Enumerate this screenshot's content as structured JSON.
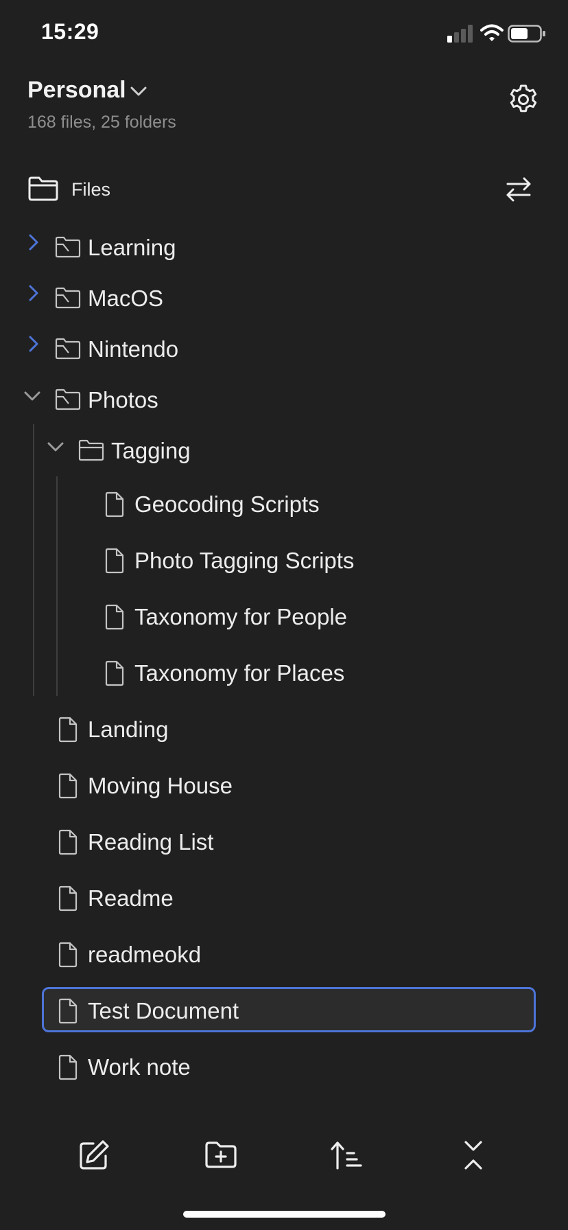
{
  "status_bar": {
    "time": "15:29"
  },
  "header": {
    "vault_name": "Personal",
    "stats": "168 files, 25 folders"
  },
  "files_section": {
    "label": "Files"
  },
  "tree": {
    "folders": [
      {
        "label": "Learning",
        "expanded": false
      },
      {
        "label": "MacOS",
        "expanded": false
      },
      {
        "label": "Nintendo",
        "expanded": false
      },
      {
        "label": "Photos",
        "expanded": true
      }
    ],
    "subfolder": {
      "label": "Tagging",
      "expanded": true
    },
    "subfolder_files": [
      {
        "label": "Geocoding Scripts"
      },
      {
        "label": "Photo Tagging Scripts"
      },
      {
        "label": "Taxonomy for People"
      },
      {
        "label": "Taxonomy for Places"
      }
    ],
    "root_files": [
      {
        "label": "Landing"
      },
      {
        "label": "Moving House"
      },
      {
        "label": "Reading List"
      },
      {
        "label": "Readme"
      },
      {
        "label": "readmeokd"
      },
      {
        "label": "Test Document",
        "selected": true
      },
      {
        "label": "Work note"
      }
    ]
  },
  "toolbar": {
    "icons": [
      "new-note-icon",
      "new-folder-icon",
      "sort-icon",
      "collapse-all-icon"
    ]
  },
  "colors": {
    "background": "#202020",
    "accent": "#4d74d8",
    "text": "#ececec",
    "muted": "#8e8e8e"
  }
}
